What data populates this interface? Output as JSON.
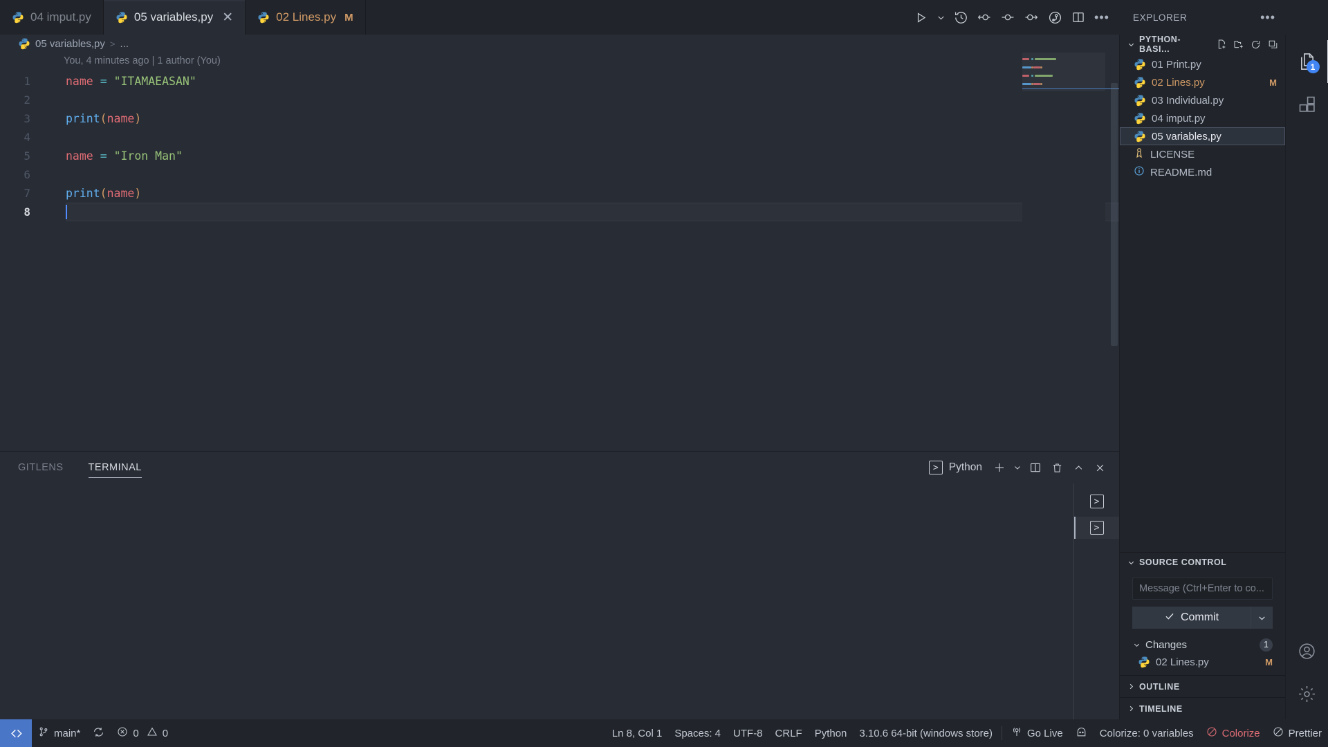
{
  "tabs": [
    {
      "label": "04 imput.py",
      "icon": "python-icon",
      "active": false,
      "modified": false,
      "closable": false
    },
    {
      "label": "05 variables,py",
      "icon": "python-icon",
      "active": true,
      "modified": false,
      "closable": true,
      "close_icon": "close-icon"
    },
    {
      "label": "02 Lines.py",
      "icon": "python-icon",
      "active": false,
      "modified": true,
      "modified_badge": "M",
      "closable": false
    }
  ],
  "editor_toolbar": [
    {
      "name": "run-python-file-button",
      "icon": "play-icon"
    },
    {
      "name": "run-options-dropdown",
      "icon": "chevron-down-icon"
    },
    {
      "name": "file-history-button",
      "icon": "history-icon"
    },
    {
      "name": "previous-change-button",
      "icon": "arrow-left-commit-icon"
    },
    {
      "name": "current-commit-button",
      "icon": "commit-dot-icon"
    },
    {
      "name": "next-change-button",
      "icon": "arrow-right-commit-icon"
    },
    {
      "name": "git-graph-button",
      "icon": "git-graph-icon"
    },
    {
      "name": "split-editor-button",
      "icon": "split-editor-icon"
    },
    {
      "name": "more-actions-button",
      "icon": "ellipsis-icon"
    }
  ],
  "breadcrumb": {
    "file": "05 variables,py",
    "separator": ">",
    "symbol": "...",
    "icon": "python-icon"
  },
  "editor": {
    "blame": "You, 4 minutes ago | 1 author (You)",
    "lines": [
      {
        "n": "1",
        "tokens": [
          {
            "t": "name",
            "c": "tk-var"
          },
          {
            "t": " ",
            "c": ""
          },
          {
            "t": "=",
            "c": "tk-op"
          },
          {
            "t": " ",
            "c": ""
          },
          {
            "t": "\"ITAMAEASAN\"",
            "c": "tk-str"
          }
        ]
      },
      {
        "n": "2",
        "tokens": []
      },
      {
        "n": "3",
        "tokens": [
          {
            "t": "print",
            "c": "tk-fn"
          },
          {
            "t": "(",
            "c": "tk-paren"
          },
          {
            "t": "name",
            "c": "tk-var"
          },
          {
            "t": ")",
            "c": "tk-paren"
          }
        ]
      },
      {
        "n": "4",
        "tokens": []
      },
      {
        "n": "5",
        "tokens": [
          {
            "t": "name",
            "c": "tk-var"
          },
          {
            "t": " ",
            "c": ""
          },
          {
            "t": "=",
            "c": "tk-op"
          },
          {
            "t": " ",
            "c": ""
          },
          {
            "t": "\"Iron Man\"",
            "c": "tk-str"
          }
        ]
      },
      {
        "n": "6",
        "tokens": []
      },
      {
        "n": "7",
        "tokens": [
          {
            "t": "print",
            "c": "tk-fn"
          },
          {
            "t": "(",
            "c": "tk-paren"
          },
          {
            "t": "name",
            "c": "tk-var"
          },
          {
            "t": ")",
            "c": "tk-paren"
          }
        ]
      },
      {
        "n": "8",
        "tokens": [],
        "current": true
      }
    ]
  },
  "panel": {
    "tabs": [
      {
        "label": "GITLENS",
        "active": false
      },
      {
        "label": "TERMINAL",
        "active": true
      }
    ],
    "terminal_chip": {
      "label": "Python",
      "icon": "terminal-icon"
    },
    "actions": [
      {
        "name": "new-terminal-button",
        "icon": "plus-icon"
      },
      {
        "name": "terminal-profile-dropdown",
        "icon": "chevron-down-icon"
      },
      {
        "name": "split-terminal-button",
        "icon": "split-editor-icon"
      },
      {
        "name": "kill-terminal-button",
        "icon": "trash-icon"
      },
      {
        "name": "maximize-panel-button",
        "icon": "chevron-up-icon"
      },
      {
        "name": "close-panel-button",
        "icon": "close-icon"
      }
    ],
    "instances": [
      {
        "icon": "terminal-icon",
        "active": false
      },
      {
        "icon": "terminal-icon",
        "active": true
      }
    ],
    "content": ""
  },
  "sidebar": {
    "title": "EXPLORER",
    "more_icon": "ellipsis-icon",
    "folder": {
      "name": "PYTHON-BASI...",
      "actions": [
        {
          "name": "new-file-button",
          "icon": "new-file-icon"
        },
        {
          "name": "new-folder-button",
          "icon": "new-folder-icon"
        },
        {
          "name": "refresh-explorer-button",
          "icon": "refresh-icon"
        },
        {
          "name": "collapse-folders-button",
          "icon": "collapse-all-icon"
        }
      ]
    },
    "files": [
      {
        "name": "01 Print.py",
        "icon": "python-icon",
        "selected": false,
        "modified": false,
        "git": ""
      },
      {
        "name": "02 Lines.py",
        "icon": "python-icon",
        "selected": false,
        "modified": true,
        "git": "M"
      },
      {
        "name": "03 Individual.py",
        "icon": "python-icon",
        "selected": false,
        "modified": false,
        "git": ""
      },
      {
        "name": "04 imput.py",
        "icon": "python-icon",
        "selected": false,
        "modified": false,
        "git": ""
      },
      {
        "name": "05 variables,py",
        "icon": "python-icon",
        "selected": true,
        "modified": false,
        "git": ""
      },
      {
        "name": "LICENSE",
        "icon": "license-icon",
        "selected": false,
        "modified": false,
        "git": ""
      },
      {
        "name": "README.md",
        "icon": "readme-info-icon",
        "selected": false,
        "modified": false,
        "git": ""
      }
    ],
    "source_control": {
      "title": "SOURCE CONTROL",
      "message_placeholder": "Message (Ctrl+Enter to co...",
      "message_value": "",
      "commit_label": "Commit",
      "commit_icon": "check-icon",
      "commit_dropdown_icon": "chevron-down-icon",
      "changes_label": "Changes",
      "changes_count": "1",
      "changes": [
        {
          "name": "02 Lines.py",
          "icon": "python-icon",
          "git": "M"
        }
      ]
    },
    "outline": {
      "title": "OUTLINE"
    },
    "timeline": {
      "title": "TIMELINE"
    }
  },
  "activity_bar": [
    {
      "name": "explorer-activity-icon",
      "icon": "files-icon",
      "active": true,
      "badge": "1"
    },
    {
      "name": "extensions-activity-icon",
      "icon": "extensions-icon",
      "active": false,
      "badge": ""
    },
    {
      "name": "accounts-activity-icon",
      "icon": "account-icon",
      "active": false,
      "badge": ""
    },
    {
      "name": "settings-activity-icon",
      "icon": "gear-icon",
      "active": false,
      "badge": ""
    }
  ],
  "status_bar": {
    "remote_icon": "remote-window-icon",
    "branch": {
      "label": "main*",
      "icon": "source-control-branch-icon"
    },
    "sync_icon": "sync-icon",
    "problems": {
      "errors": "0",
      "warnings": "0",
      "error_icon": "error-circle-icon",
      "warning_icon": "warning-triangle-icon"
    },
    "right": [
      {
        "name": "editor-position",
        "label": "Ln 8, Col 1"
      },
      {
        "name": "indentation",
        "label": "Spaces: 4"
      },
      {
        "name": "encoding",
        "label": "UTF-8"
      },
      {
        "name": "end-of-line",
        "label": "CRLF"
      },
      {
        "name": "language-mode",
        "label": "Python"
      },
      {
        "name": "python-interpreter",
        "label": "3.10.6 64-bit (windows store)"
      },
      {
        "name": "go-live",
        "label": "Go Live",
        "icon": "broadcast-icon"
      },
      {
        "name": "live-share",
        "label": "",
        "icon": "live-share-icon"
      },
      {
        "name": "colorize-count",
        "label": "Colorize: 0 variables"
      },
      {
        "name": "colorize-toggle",
        "label": "Colorize",
        "icon": "blocked-icon",
        "accent": "#e06c75"
      },
      {
        "name": "prettier",
        "label": "Prettier",
        "icon": "blocked-icon"
      }
    ]
  },
  "colors": {
    "editor_bg": "#282c34",
    "chrome_bg": "#21252b",
    "accent_blue": "#4a76c8",
    "string_green": "#98c379",
    "variable_red": "#e06c75",
    "function_blue": "#61afef",
    "modified_orange": "#d19a66",
    "badge_blue": "#4285f4"
  }
}
